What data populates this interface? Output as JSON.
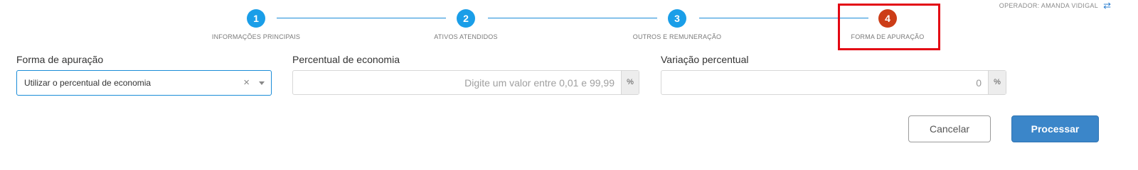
{
  "header": {
    "operator": "OPERADOR: AMANDA VIDIGAL",
    "swap_icon": "swap-arrows-icon"
  },
  "stepper": {
    "steps": [
      {
        "number": "1",
        "label": "INFORMAÇÕES PRINCIPAIS",
        "active": false
      },
      {
        "number": "2",
        "label": "ATIVOS ATENDIDOS",
        "active": false
      },
      {
        "number": "3",
        "label": "OUTROS E REMUNERAÇÃO",
        "active": false
      },
      {
        "number": "4",
        "label": "FORMA DE APURAÇÃO",
        "active": true
      }
    ],
    "colors": {
      "step": "#1a9ee8",
      "active_step": "#cc3d17",
      "highlight": "#e30613"
    }
  },
  "form": {
    "forma_apuracao": {
      "label": "Forma de apuração",
      "value": "Utilizar o percentual de economia",
      "clear_glyph": "×"
    },
    "percentual_economia": {
      "label": "Percentual de economia",
      "placeholder": "Digite um valor entre 0,01 e 99,99",
      "value": "",
      "unit": "%"
    },
    "variacao_percentual": {
      "label": "Variação percentual",
      "value": "0",
      "unit": "%"
    }
  },
  "actions": {
    "cancel_label": "Cancelar",
    "process_label": "Processar",
    "primary_color": "#3b86c9"
  }
}
